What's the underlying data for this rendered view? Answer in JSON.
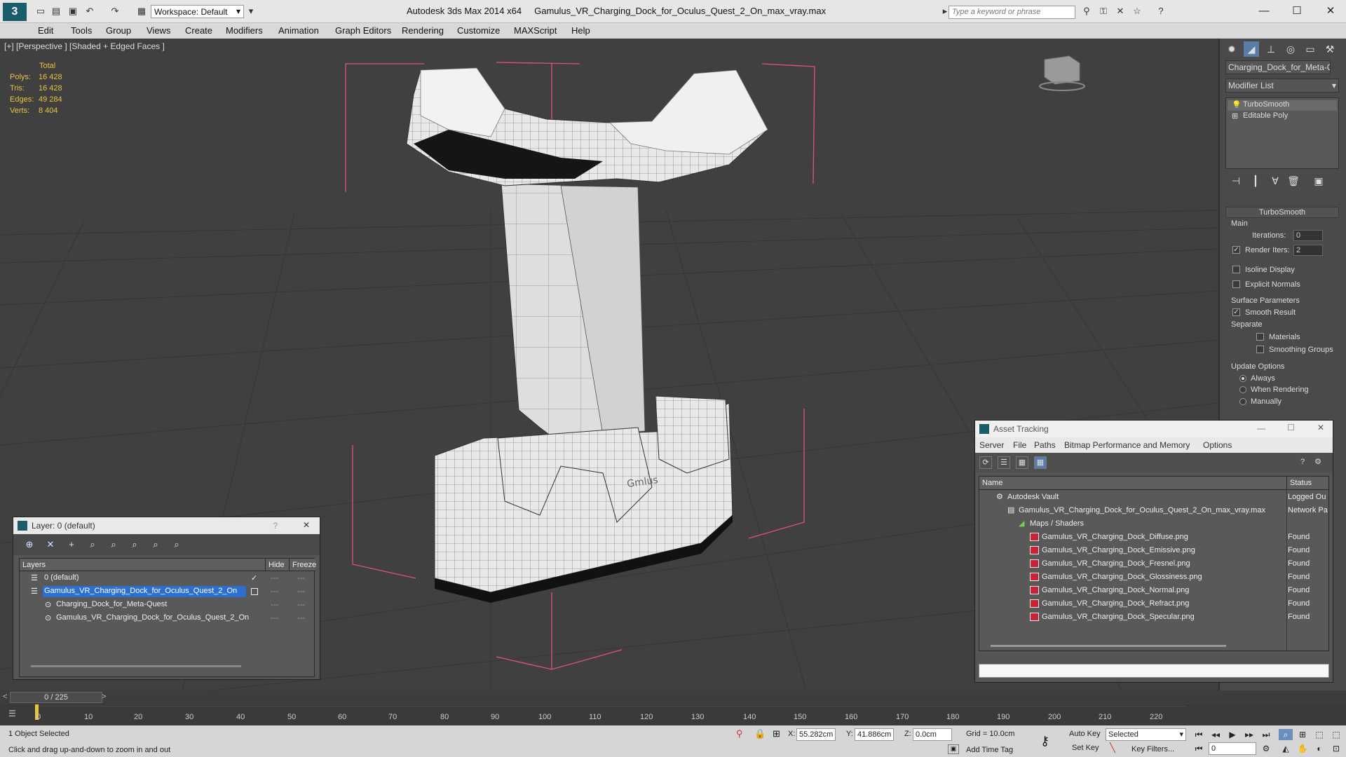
{
  "app": {
    "title": "Autodesk 3ds Max  2014 x64",
    "file": "Gamulus_VR_Charging_Dock_for_Oculus_Quest_2_On_max_vray.max",
    "workspace": "Workspace: Default",
    "search_placeholder": "Type a keyword or phrase"
  },
  "menu": [
    "Edit",
    "Tools",
    "Group",
    "Views",
    "Create",
    "Modifiers",
    "Animation",
    "Graph Editors",
    "Rendering",
    "Customize",
    "MAXScript",
    "Help"
  ],
  "viewport": {
    "label": "[+] [Perspective ] [Shaded + Edged Faces ]",
    "stats": {
      "header": "Total",
      "rows": [
        {
          "k": "Polys:",
          "v": "16 428"
        },
        {
          "k": "Tris:",
          "v": "16 428"
        },
        {
          "k": "Edges:",
          "v": "49 284"
        },
        {
          "k": "Verts:",
          "v": "8 404"
        }
      ]
    },
    "logo_text": "Gmlus"
  },
  "command_panel": {
    "object_name": "Charging_Dock_for_Meta-Qu",
    "modifier_list": "Modifier List",
    "stack": [
      "TurboSmooth",
      "Editable Poly"
    ],
    "rollout_title": "TurboSmooth",
    "main_label": "Main",
    "iterations_label": "Iterations:",
    "iterations_value": "0",
    "render_iters_label": "Render Iters:",
    "render_iters_value": "2",
    "isoline": "Isoline Display",
    "explicit_normals": "Explicit Normals",
    "surface_params": "Surface Parameters",
    "smooth_result": "Smooth Result",
    "separate": "Separate",
    "materials": "Materials",
    "smoothing_groups": "Smoothing Groups",
    "update_options": "Update Options",
    "always": "Always",
    "when_rendering": "When Rendering",
    "manually": "Manually"
  },
  "layer_window": {
    "title": "Layer: 0 (default)",
    "col_layers": "Layers",
    "col_hide": "Hide",
    "col_freeze": "Freeze",
    "rows": [
      {
        "name": "0 (default)"
      },
      {
        "name": "Gamulus_VR_Charging_Dock_for_Oculus_Quest_2_On"
      },
      {
        "name": "Charging_Dock_for_Meta-Quest"
      },
      {
        "name": "Gamulus_VR_Charging_Dock_for_Oculus_Quest_2_On"
      }
    ],
    "dash": "---"
  },
  "asset_window": {
    "title": "Asset Tracking",
    "menu": [
      "Server",
      "File",
      "Paths",
      "Bitmap Performance and Memory",
      "Options"
    ],
    "col_name": "Name",
    "col_status": "Status",
    "rows": [
      {
        "name": "Autodesk Vault",
        "status": "Logged Ou"
      },
      {
        "name": "Gamulus_VR_Charging_Dock_for_Oculus_Quest_2_On_max_vray.max",
        "status": "Network Pa"
      },
      {
        "name": "Maps / Shaders",
        "status": ""
      },
      {
        "name": "Gamulus_VR_Charging_Dock_Diffuse.png",
        "status": "Found"
      },
      {
        "name": "Gamulus_VR_Charging_Dock_Emissive.png",
        "status": "Found"
      },
      {
        "name": "Gamulus_VR_Charging_Dock_Fresnel.png",
        "status": "Found"
      },
      {
        "name": "Gamulus_VR_Charging_Dock_Glossiness.png",
        "status": "Found"
      },
      {
        "name": "Gamulus_VR_Charging_Dock_Normal.png",
        "status": "Found"
      },
      {
        "name": "Gamulus_VR_Charging_Dock_Refract.png",
        "status": "Found"
      },
      {
        "name": "Gamulus_VR_Charging_Dock_Specular.png",
        "status": "Found"
      }
    ]
  },
  "timeline": {
    "frame": "0 / 225",
    "ticks": [
      "0",
      "10",
      "20",
      "30",
      "40",
      "50",
      "60",
      "70",
      "80",
      "90",
      "100",
      "110",
      "120",
      "130",
      "140",
      "150",
      "160",
      "170",
      "180",
      "190",
      "200",
      "210",
      "220"
    ]
  },
  "status": {
    "selected": "1 Object Selected",
    "prompt": "Click and drag up-and-down to zoom in and out",
    "x_label": "X:",
    "x_value": "55.282cm",
    "y_label": "Y:",
    "y_value": "41.886cm",
    "z_label": "Z:",
    "z_value": "0.0cm",
    "grid": "Grid = 10.0cm",
    "add_time_tag": "Add Time Tag",
    "auto_key": "Auto Key",
    "auto_key_value": "Selected",
    "set_key": "Set Key",
    "key_filters": "Key Filters...",
    "frame_value": "0"
  },
  "colors": {
    "accent_selection": "#2c6fcf",
    "stats_yellow": "#e8c33c",
    "bbox_pink": "#e0508a"
  }
}
